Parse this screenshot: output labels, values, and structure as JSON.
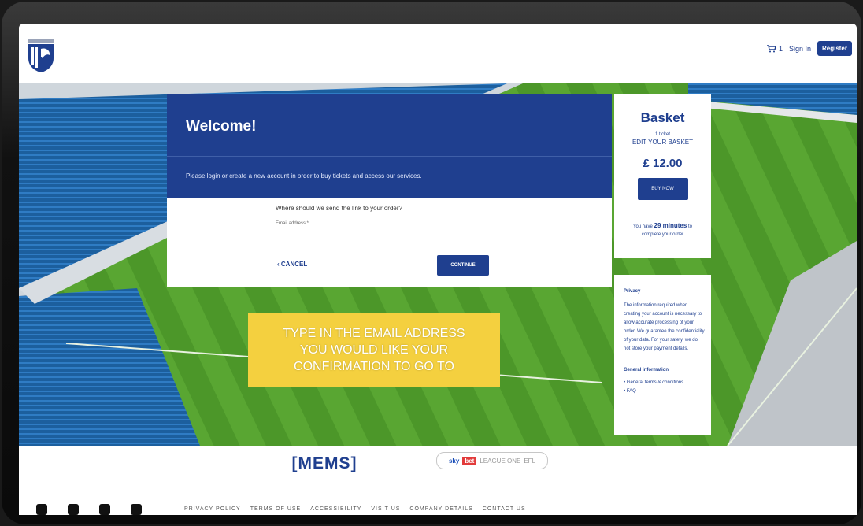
{
  "header": {
    "cart_count": "1",
    "signin_label": "Sign In",
    "register_label": "Register"
  },
  "welcome": {
    "title": "Welcome!",
    "subtitle": "Please login or create a new account in order to buy tickets and access our services.",
    "question": "Where should we send the link to your order?",
    "email_label": "Email address *",
    "cancel_label": "CANCEL",
    "continue_label": "CONTINUE"
  },
  "basket": {
    "title": "Basket",
    "ticket_count": "1 ticket",
    "edit_label": "EDIT YOUR BASKET",
    "price": "£ 12.00",
    "buy_label": "BUY NOW",
    "time_prefix": "You have",
    "time_value": "29 minutes",
    "time_suffix": "to complete your order"
  },
  "privacy": {
    "title": "Privacy",
    "text": "The information required when creating your account is necessary to allow accurate processing of your order. We guarantee the confidentiality of your data. For your safety, we do not store your payment details.",
    "general_title": "General information",
    "links": [
      "General terms & conditions",
      "FAQ"
    ]
  },
  "callout": {
    "text": "TYPE IN THE EMAIL ADDRESS\nYOU WOULD LIKE YOUR\nCONFIRMATION TO GO TO"
  },
  "footer": {
    "sponsor": "MEMS",
    "league_sky": "sky",
    "league_bet": "bet",
    "league_text": "LEAGUE ONE",
    "league_efl": "EFL",
    "links": [
      "PRIVACY POLICY",
      "TERMS OF USE",
      "ACCESSIBILITY",
      "VISIT US",
      "COMPANY DETAILS",
      "CONTACT US"
    ],
    "social_icons": [
      "twitter-icon",
      "facebook-icon",
      "youtube-icon",
      "instagram-icon"
    ]
  },
  "colors": {
    "brand_blue": "#1f3f8f",
    "callout_yellow": "#f4d03f",
    "pitch_green": "#4f9a2c"
  }
}
